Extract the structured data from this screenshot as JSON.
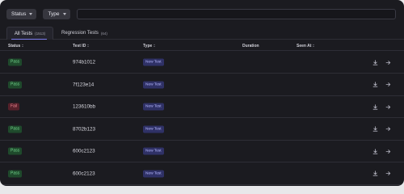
{
  "filters": {
    "status_label": "Status",
    "type_label": "Type",
    "search_placeholder": ""
  },
  "tabs": [
    {
      "label": "All Tests",
      "count": "(1513)"
    },
    {
      "label": "Regression Tests",
      "count": "(64)"
    }
  ],
  "columns": {
    "status": "Status",
    "test_id": "Test ID",
    "type": "Type",
    "duration": "Duration",
    "seen_at": "Seen At"
  },
  "rows": [
    {
      "status": "Pass",
      "test_id": "974b1012",
      "type": "New Test"
    },
    {
      "status": "Pass",
      "test_id": "7f123e14",
      "type": "New Test"
    },
    {
      "status": "Fail",
      "test_id": "123610bb",
      "type": "New Test"
    },
    {
      "status": "Pass",
      "test_id": "8702b123",
      "type": "New Test"
    },
    {
      "status": "Pass",
      "test_id": "600c2123",
      "type": "New Test"
    },
    {
      "status": "Pass",
      "test_id": "600c2123",
      "type": "New Test"
    }
  ],
  "icons": {
    "row_download": "download-icon",
    "row_open": "arrow-right-icon",
    "dropdown": "chevron-down-icon",
    "sort": "sort-icon"
  },
  "colors": {
    "background": "#1b1b20",
    "pass_bg": "#1f4a2c",
    "pass_text": "#74d68e",
    "fail_bg": "#56202a",
    "fail_text": "#f08a96",
    "type_bg": "#2f3166",
    "type_text": "#b6b8ff",
    "accent": "#7c7cf0"
  }
}
